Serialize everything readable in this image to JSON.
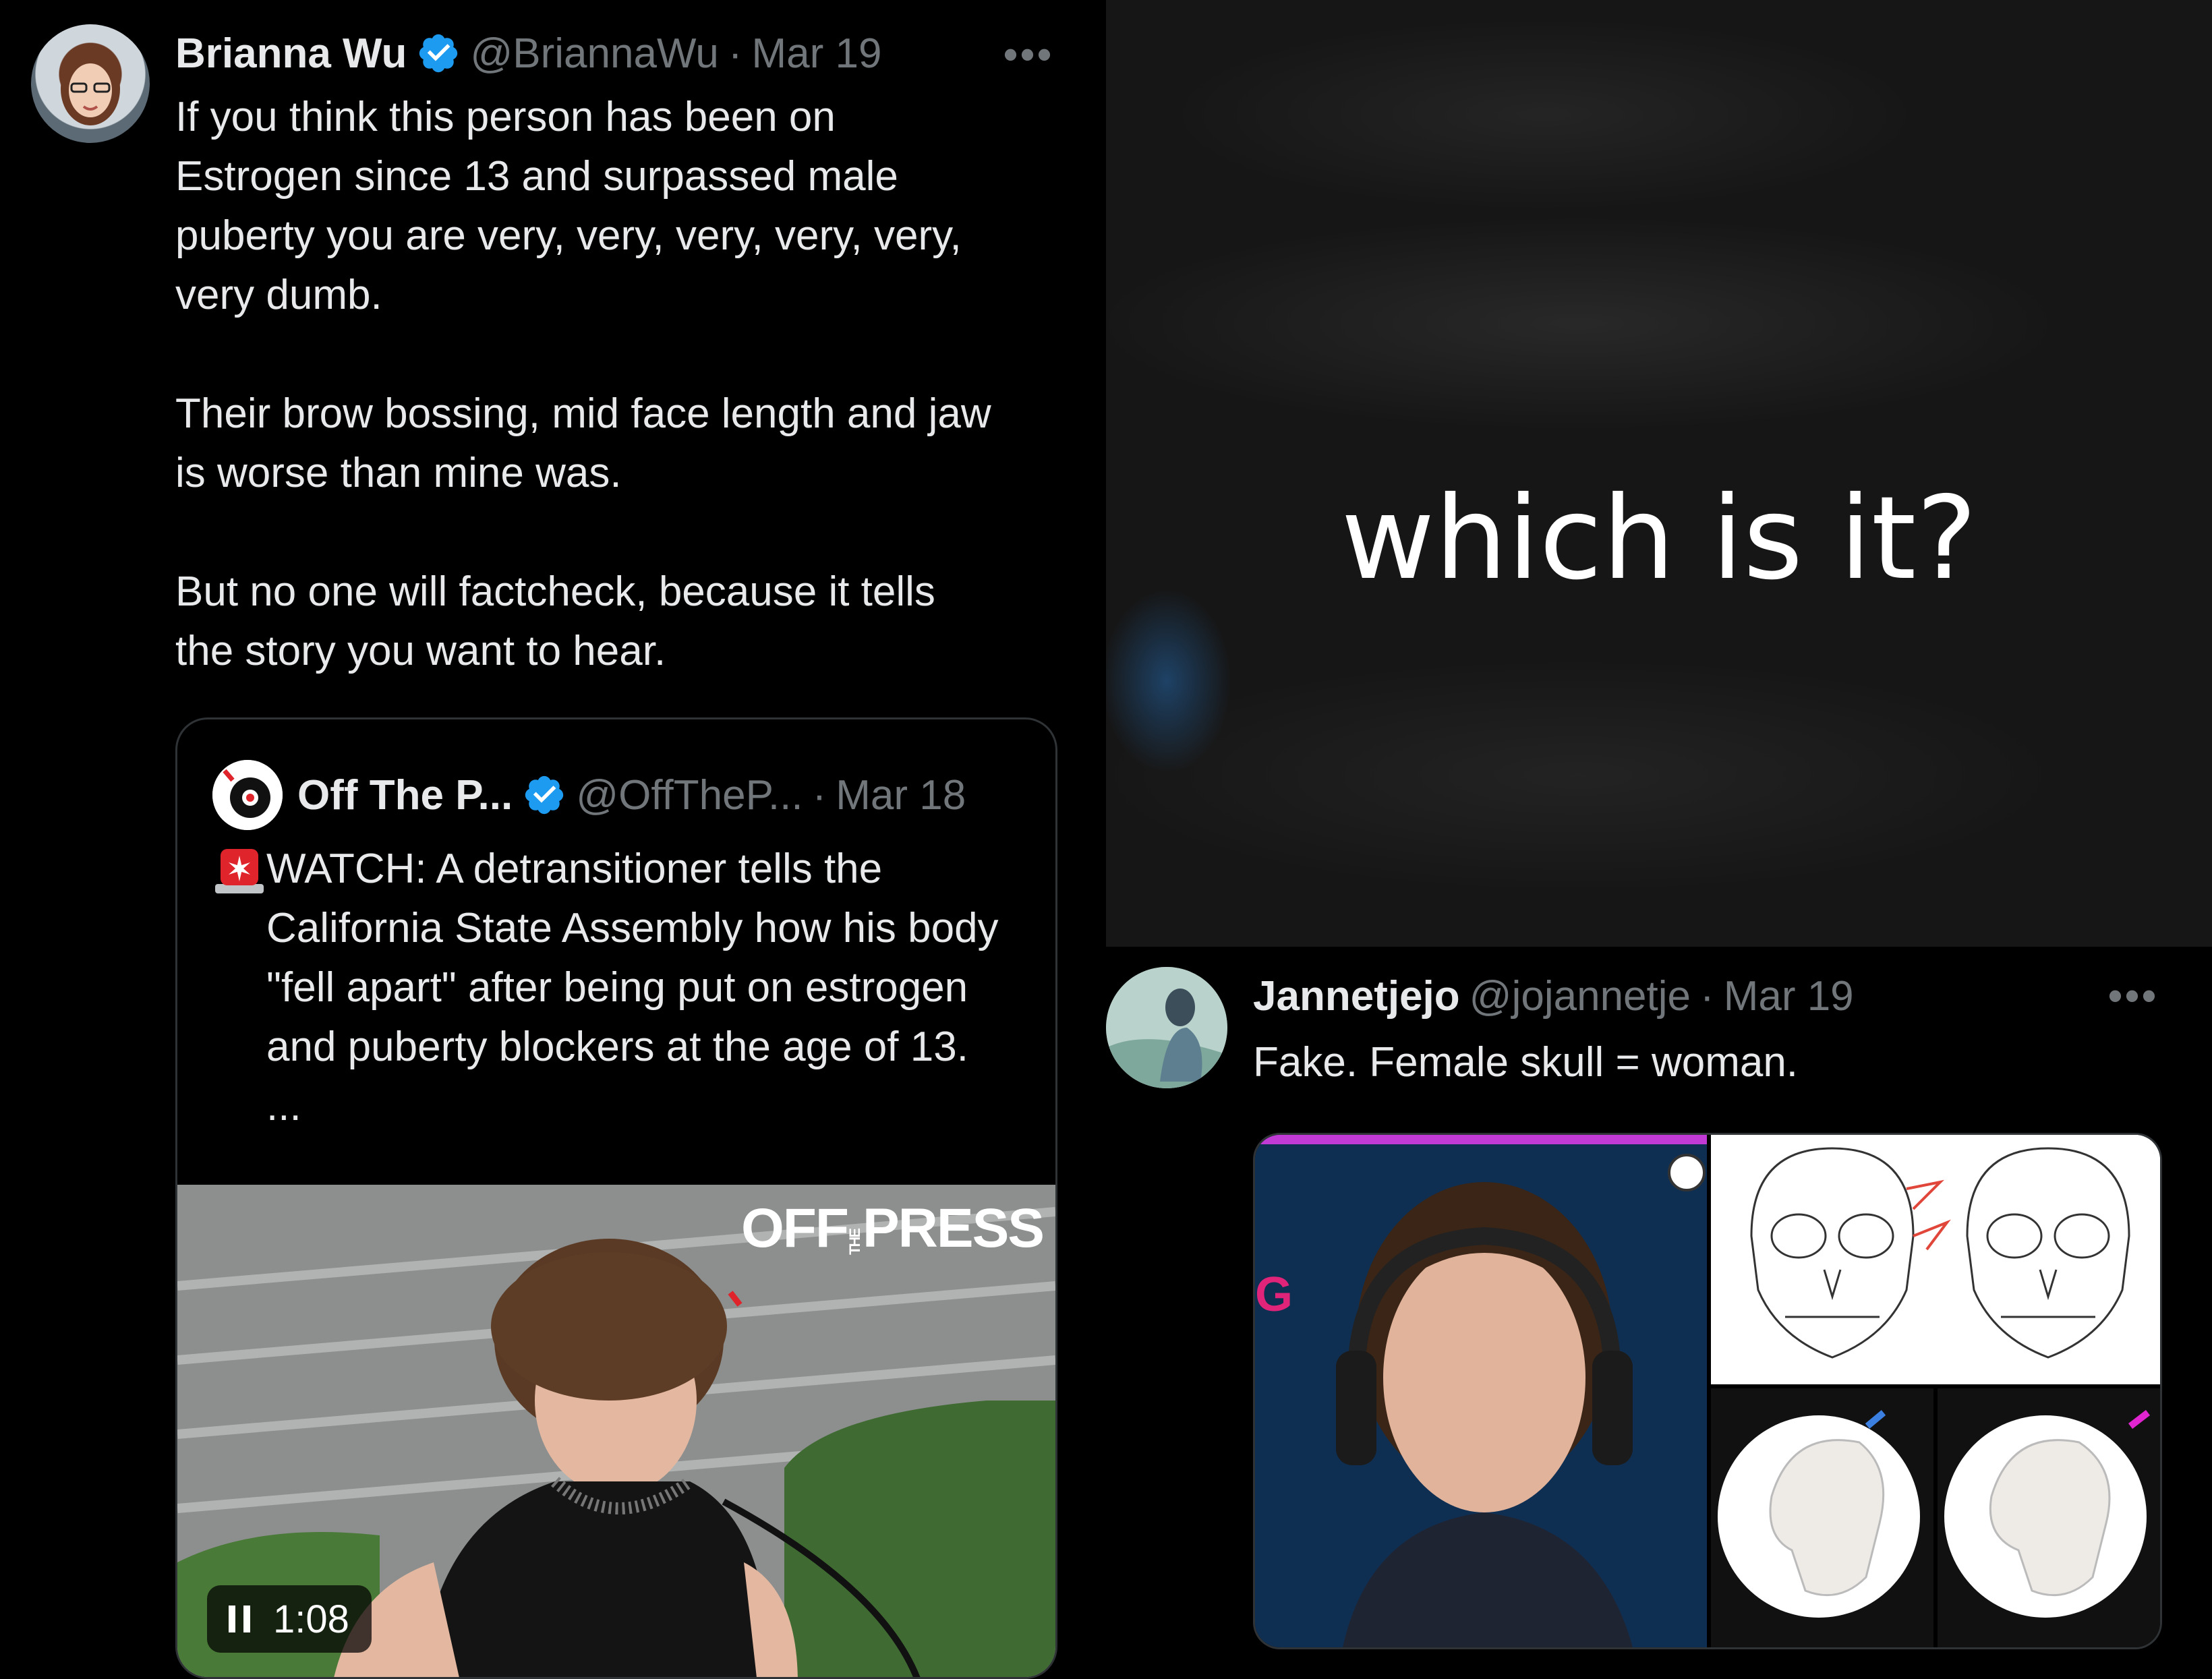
{
  "tweet1": {
    "name": "Brianna Wu",
    "handle": "@BriannaWu",
    "date": "Mar 19",
    "more": "•••",
    "text": "If you think this person has been on\nEstrogen since 13 and surpassed male\npuberty you are very, very, very, very, very,\nvery dumb.\n\nTheir brow bossing, mid face length and jaw\nis worse than mine was.\n\nBut no one will factcheck, because it tells\nthe story you want to hear."
  },
  "quote": {
    "name": "Off The P...",
    "handle": "@OffTheP...",
    "date": "Mar 18",
    "alert_emoji": "🚨",
    "text": "WATCH: A detransitioner tells the\nCalifornia State Assembly how his body\n\"fell apart\" after being put on estrogen\nand puberty blockers at the age of 13.\n...",
    "video": {
      "watermark_left": "OFF",
      "watermark_mid": "THE",
      "watermark_right": "PRESS",
      "time": "1:08",
      "pause_icon": "pause-icon"
    }
  },
  "blur_panel": {
    "caption": "which is it?"
  },
  "tweet2": {
    "name": "Jannetjejo",
    "handle": "@jojannetje",
    "date": "Mar 19",
    "more": "•••",
    "text": "Fake. Female skull = woman.",
    "media_letter": "G"
  },
  "colors": {
    "background": "#000000",
    "text_primary": "#e7e9ea",
    "text_secondary": "#71767b",
    "verified": "#1d9bf0",
    "border": "#2f3336"
  }
}
